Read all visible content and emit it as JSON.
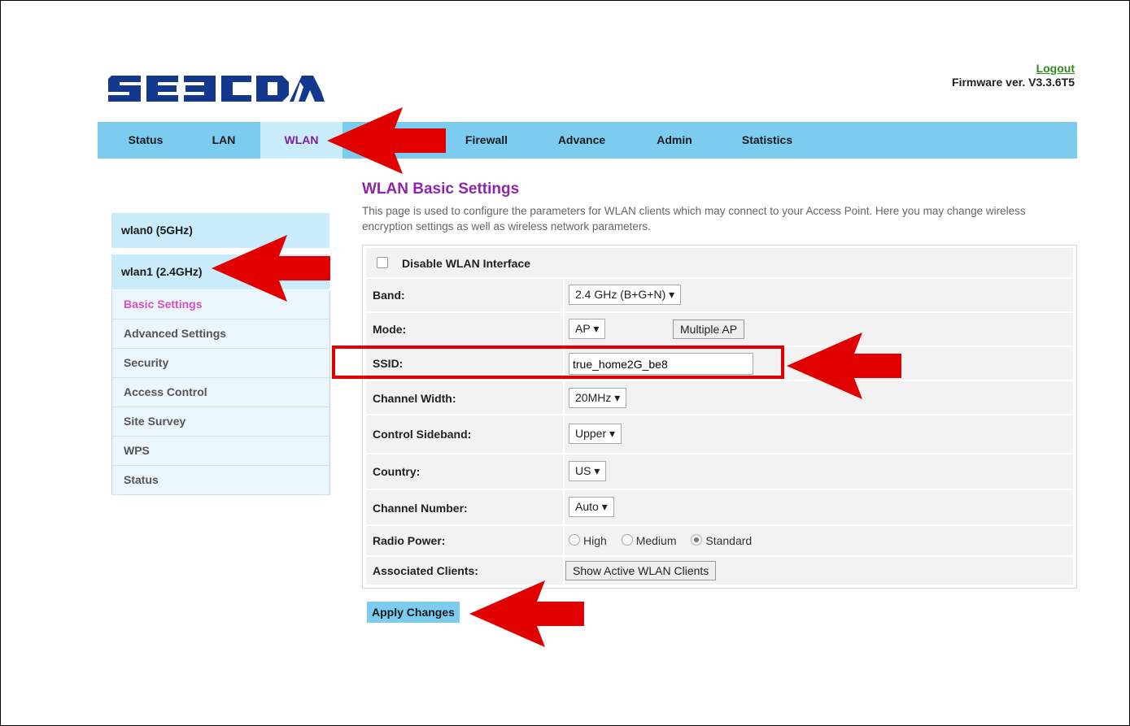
{
  "brand": {
    "logo_text": "SERCOM"
  },
  "header": {
    "logout_label": "Logout",
    "firmware_label": "Firmware ver. V3.3.6T5"
  },
  "nav": {
    "items": [
      "Status",
      "LAN",
      "WLAN",
      "Firewall",
      "Advance",
      "Admin",
      "Statistics"
    ],
    "active": "WLAN"
  },
  "sidebar": {
    "interfaces": [
      "wlan0 (5GHz)",
      "wlan1 (2.4GHz)"
    ],
    "links": [
      "Basic Settings",
      "Advanced Settings",
      "Security",
      "Access Control",
      "Site Survey",
      "WPS",
      "Status"
    ],
    "active_link": "Basic Settings"
  },
  "page": {
    "title": "WLAN Basic Settings",
    "description": "This page is used to configure the parameters for WLAN clients which may connect to your Access Point. Here you may change wireless encryption settings as well as wireless network parameters."
  },
  "form": {
    "disable_label": "Disable WLAN Interface",
    "disable_checked": false,
    "band_label": "Band:",
    "band_value": "2.4 GHz (B+G+N)",
    "mode_label": "Mode:",
    "mode_value": "AP",
    "multiple_ap_label": "Multiple AP",
    "ssid_label": "SSID:",
    "ssid_value": "true_home2G_be8",
    "channel_width_label": "Channel Width:",
    "channel_width_value": "20MHz",
    "sideband_label": "Control Sideband:",
    "sideband_value": "Upper",
    "country_label": "Country:",
    "country_value": "US",
    "channel_number_label": "Channel Number:",
    "channel_number_value": "Auto",
    "radio_power_label": "Radio Power:",
    "radio_power_options": [
      "High",
      "Medium",
      "Standard"
    ],
    "radio_power_selected": "Standard",
    "clients_label": "Associated Clients:",
    "show_clients_label": "Show Active WLAN Clients"
  },
  "apply_label": "Apply Changes",
  "annotation_color": "#e10000",
  "dropdown_glyph": "▾"
}
